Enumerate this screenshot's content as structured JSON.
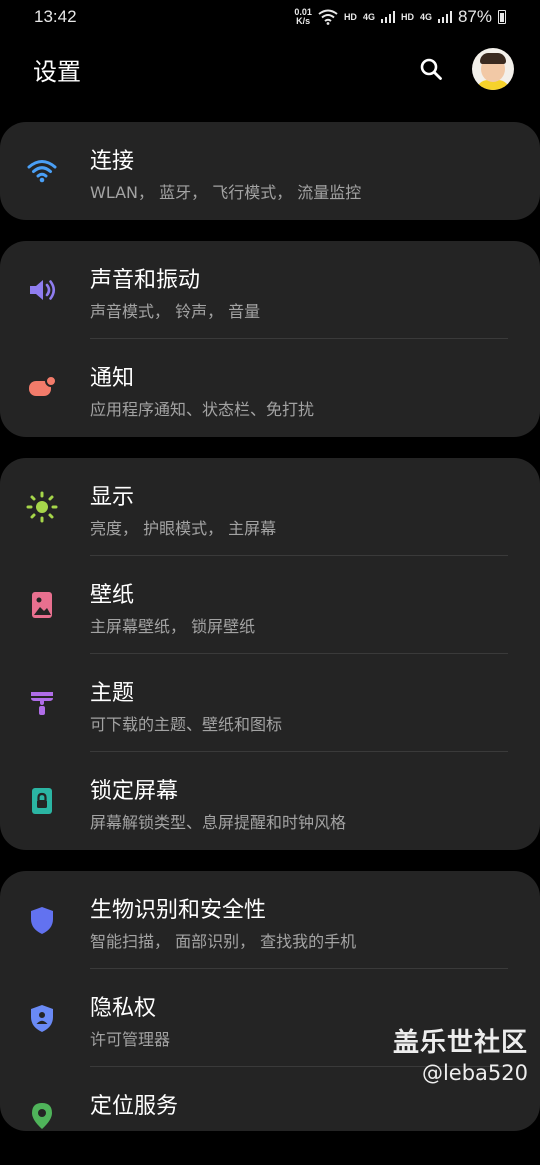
{
  "status_bar": {
    "time": "13:42",
    "net_speed_value": "0.01",
    "net_speed_unit": "K/s",
    "hd1": "HD",
    "lte1": "4G",
    "hd2": "HD",
    "lte2": "4G",
    "battery": "87%"
  },
  "header": {
    "title": "设置"
  },
  "groups": [
    {
      "items": [
        {
          "title": "连接",
          "subtitle": "WLAN， 蓝牙， 飞行模式， 流量监控",
          "icon": "wifi-icon",
          "color": "#4a9ff5"
        }
      ]
    },
    {
      "items": [
        {
          "title": "声音和振动",
          "subtitle": "声音模式， 铃声， 音量",
          "icon": "speaker-icon",
          "color": "#8f7df0"
        },
        {
          "title": "通知",
          "subtitle": "应用程序通知、状态栏、免打扰",
          "icon": "notification-icon",
          "color": "#f27b6a"
        }
      ]
    },
    {
      "items": [
        {
          "title": "显示",
          "subtitle": "亮度， 护眼模式， 主屏幕",
          "icon": "brightness-icon",
          "color": "#a6d64a"
        },
        {
          "title": "壁纸",
          "subtitle": "主屏幕壁纸， 锁屏壁纸",
          "icon": "wallpaper-icon",
          "color": "#e8708f"
        },
        {
          "title": "主题",
          "subtitle": "可下载的主题、壁纸和图标",
          "icon": "theme-brush-icon",
          "color": "#b06de8"
        },
        {
          "title": "锁定屏幕",
          "subtitle": "屏幕解锁类型、息屏提醒和时钟风格",
          "icon": "lock-icon",
          "color": "#2bb5a3"
        }
      ]
    },
    {
      "items": [
        {
          "title": "生物识别和安全性",
          "subtitle": "智能扫描， 面部识别， 查找我的手机",
          "icon": "shield-icon",
          "color": "#6272f0"
        },
        {
          "title": "隐私权",
          "subtitle": "许可管理器",
          "icon": "privacy-shield-icon",
          "color": "#6a8af5"
        },
        {
          "title": "定位服务",
          "subtitle": "",
          "icon": "location-icon",
          "color": "#4fb35a"
        }
      ]
    }
  ],
  "watermark": {
    "line1": "盖乐世社区",
    "line2": "@leba520"
  }
}
